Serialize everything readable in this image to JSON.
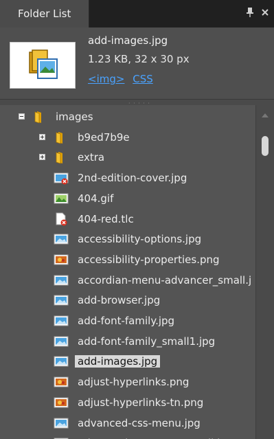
{
  "panel": {
    "tab_title": "Folder List",
    "pin_icon": "pin-icon",
    "close_icon": "close-icon"
  },
  "info": {
    "file_name": "add-images.jpg",
    "file_meta": "1.23 KB, 32 x 30 px",
    "link_img": "<img>",
    "link_css": "CSS"
  },
  "tree": {
    "rows": [
      {
        "label": "images",
        "icon": "folder-icon",
        "expander": "minus"
      },
      {
        "label": "b9ed7b9e",
        "icon": "folder-icon",
        "expander": "plus"
      },
      {
        "label": "extra",
        "icon": "folder-icon",
        "expander": "plus"
      },
      {
        "label": "2nd-edition-cover.jpg",
        "icon": "image-error-icon"
      },
      {
        "label": "404.gif",
        "icon": "gif-icon"
      },
      {
        "label": "404-red.tlc",
        "icon": "file-error-icon"
      },
      {
        "label": "accessibility-options.jpg",
        "icon": "jpg-icon"
      },
      {
        "label": "accessibility-properties.png",
        "icon": "png-icon"
      },
      {
        "label": "accordian-menu-advancer_small.j",
        "icon": "jpg-icon"
      },
      {
        "label": "add-browser.jpg",
        "icon": "jpg-icon"
      },
      {
        "label": "add-font-family.jpg",
        "icon": "jpg-icon"
      },
      {
        "label": "add-font-family_small1.jpg",
        "icon": "jpg-icon"
      },
      {
        "label": "add-images.jpg",
        "icon": "jpg-icon",
        "selected": true
      },
      {
        "label": "adjust-hyperlinks.png",
        "icon": "png-icon"
      },
      {
        "label": "adjust-hyperlinks-tn.png",
        "icon": "png-icon"
      },
      {
        "label": "advanced-css-menu.jpg",
        "icon": "jpg-icon"
      },
      {
        "label": "advanced-css-menu_small.jpg",
        "icon": "jpg-icon"
      }
    ]
  },
  "colors": {
    "accent_link": "#4aa3ff",
    "folder": "#f0b400",
    "selection": "#d8d8d8"
  }
}
